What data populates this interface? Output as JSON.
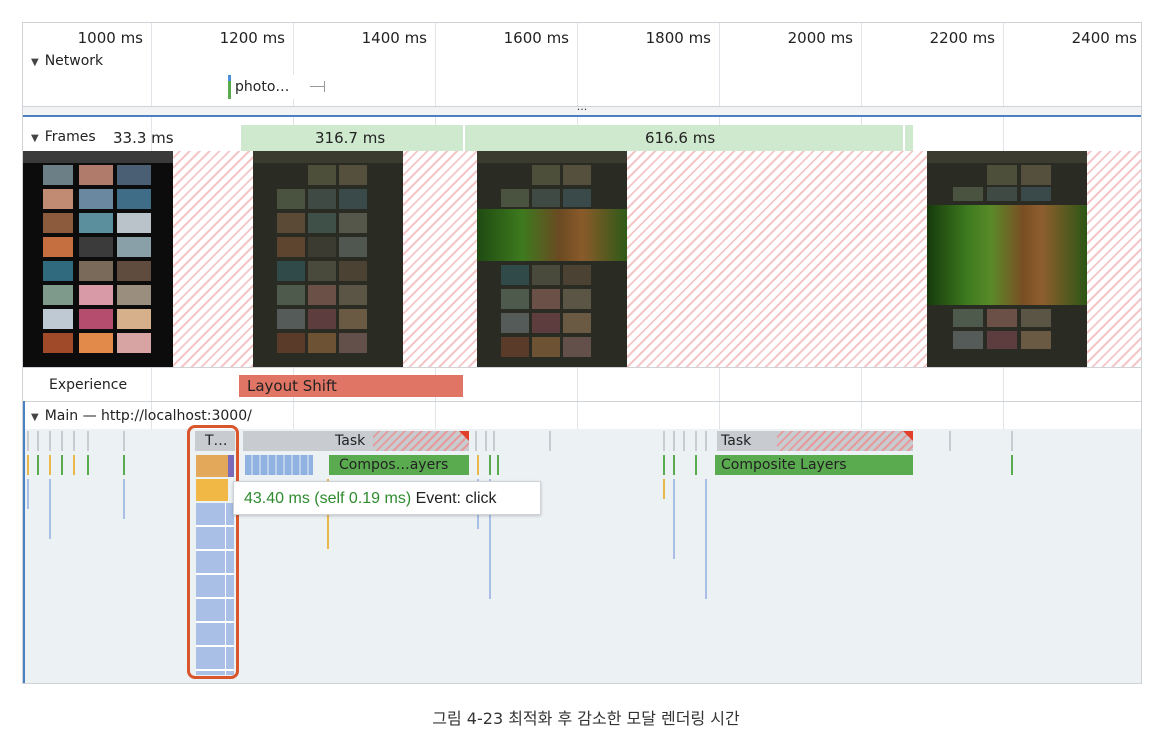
{
  "timeline": {
    "ticks": [
      "1000 ms",
      "1200 ms",
      "1400 ms",
      "1600 ms",
      "1800 ms",
      "2000 ms",
      "2200 ms",
      "2400 ms"
    ]
  },
  "network": {
    "title": "Network",
    "request_label": "photo…"
  },
  "divider_dots": "···",
  "frames": {
    "title": "Frames",
    "first_duration": "33.3 ms",
    "bar1_label": "316.7 ms",
    "bar2_label": "616.6 ms"
  },
  "experience": {
    "title": "Experience",
    "layout_shift_label": "Layout Shift"
  },
  "main": {
    "title": "Main — http://localhost:3000/",
    "task_short": "T…",
    "task1_label": "Task",
    "task2_label": "Task",
    "composite1_label": "Compos…ayers",
    "composite2_label": "Composite Layers"
  },
  "tooltip": {
    "duration": "43.40 ms (self 0.19 ms)",
    "event": "Event: click"
  },
  "caption": "그림 4-23 최적화 후 감소한 모달 렌더링 시간",
  "colors": {
    "network_bar": "#5aaa50",
    "frame_bar": "#cfe9cf",
    "layout_shift": "#e07565",
    "task": "#c8cbd0",
    "composite": "#5aaa50",
    "highlight": "#d9552c",
    "tooltip_green": "#2e8b2e"
  }
}
